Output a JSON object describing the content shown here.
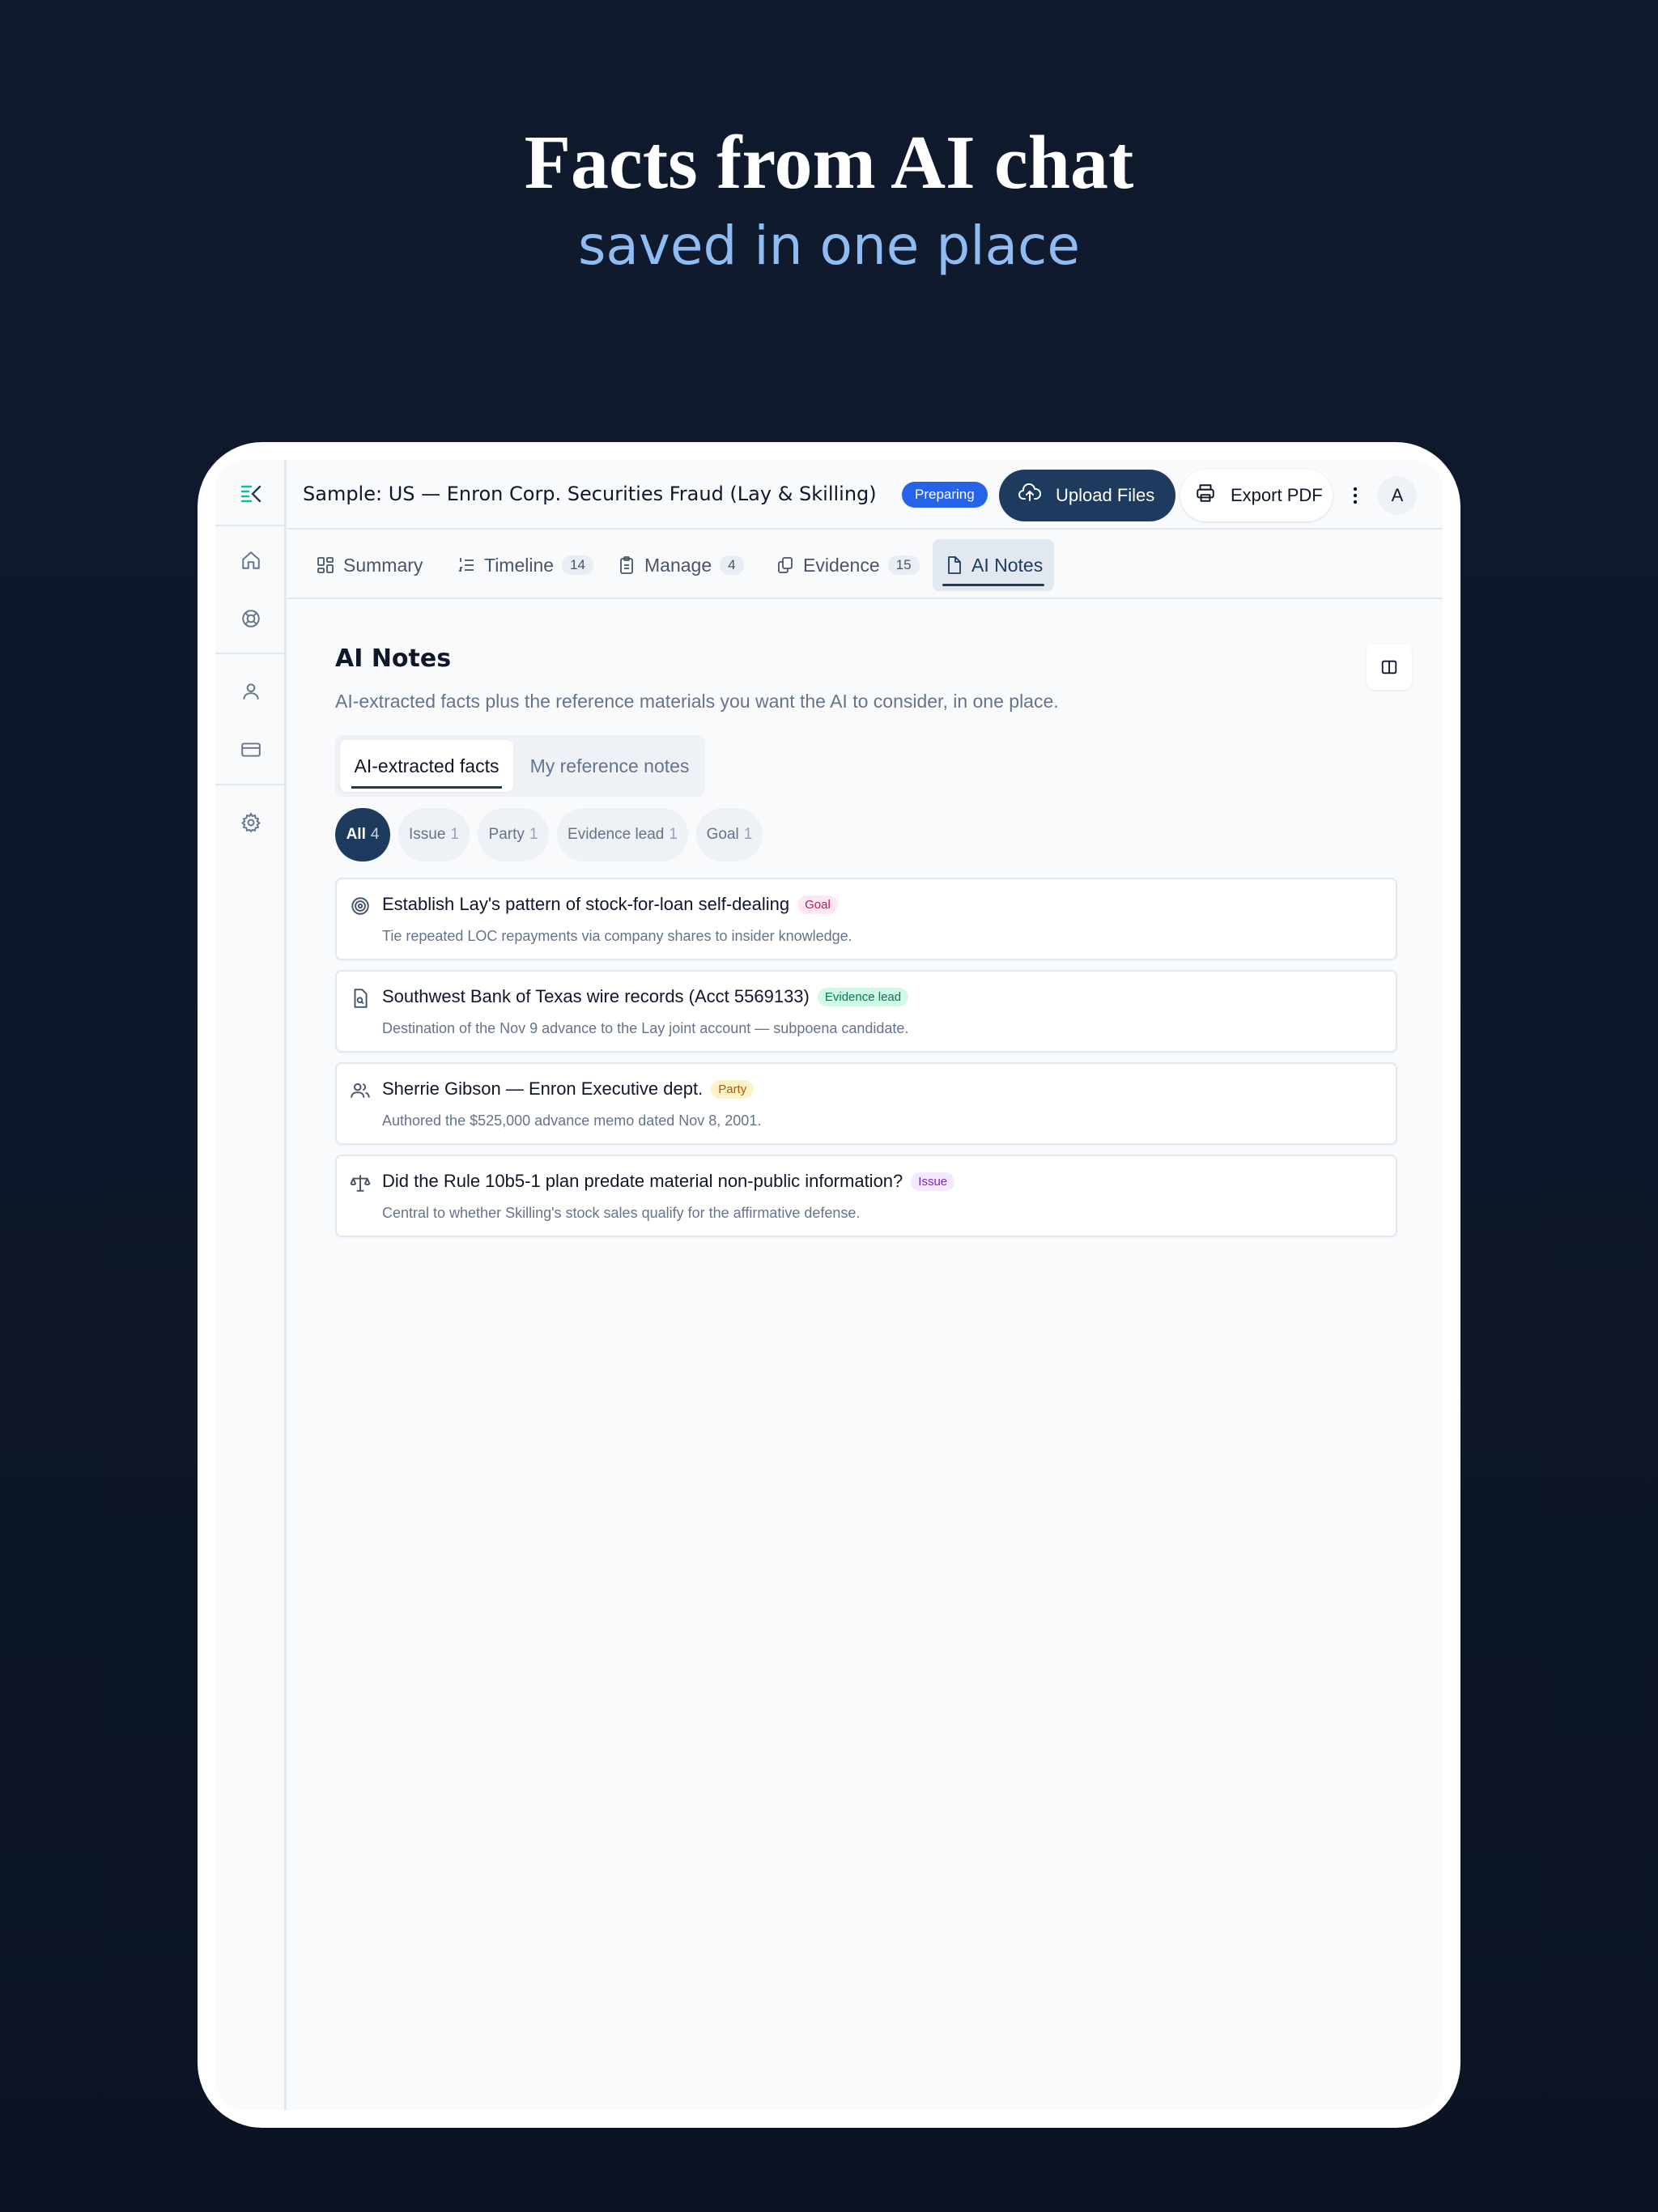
{
  "hero": {
    "title": "Facts from AI chat",
    "subtitle": "saved in one place"
  },
  "sidebar": {
    "items": [
      {
        "name": "logo",
        "icon": "logo-icon"
      },
      {
        "name": "home",
        "icon": "home-icon"
      },
      {
        "name": "help",
        "icon": "lifebuoy-icon"
      },
      {
        "name": "profile",
        "icon": "user-icon"
      },
      {
        "name": "billing",
        "icon": "credit-card-icon"
      },
      {
        "name": "settings",
        "icon": "gear-icon"
      }
    ]
  },
  "header": {
    "case_title": "Sample: US — Enron Corp. Securities Fraud (Lay & Skilling)",
    "status": "Preparing",
    "upload_label": "Upload Files",
    "export_label": "Export PDF",
    "avatar_initial": "A"
  },
  "tabs": [
    {
      "label": "Summary",
      "count": "",
      "icon": "grid-icon"
    },
    {
      "label": "Timeline",
      "count": "14",
      "icon": "list-ordered-icon"
    },
    {
      "label": "Manage",
      "count": "4",
      "icon": "clipboard-icon"
    },
    {
      "label": "Evidence",
      "count": "15",
      "icon": "files-icon"
    },
    {
      "label": "AI Notes",
      "count": "",
      "icon": "file-icon",
      "active": true
    }
  ],
  "main": {
    "title": "AI Notes",
    "description": "AI-extracted facts plus the reference materials you want the AI to consider, in one place.",
    "subtabs": [
      {
        "label": "AI-extracted facts",
        "active": true
      },
      {
        "label": "My reference notes"
      }
    ],
    "filters": [
      {
        "label": "All",
        "count": "4",
        "active": true
      },
      {
        "label": "Issue",
        "count": "1"
      },
      {
        "label": "Party",
        "count": "1"
      },
      {
        "label": "Evidence lead",
        "count": "1"
      },
      {
        "label": "Goal",
        "count": "1"
      }
    ],
    "facts": [
      {
        "title": "Establish Lay's pattern of stock-for-loan self-dealing",
        "tag": "Goal",
        "description": "Tie repeated LOC repayments via company shares to insider knowledge.",
        "icon": "target-icon"
      },
      {
        "title": "Southwest Bank of Texas wire records (Acct 5569133)",
        "tag": "Evidence lead",
        "description": "Destination of the Nov 9 advance to the Lay joint account — subpoena candidate.",
        "icon": "file-search-icon"
      },
      {
        "title": "Sherrie Gibson — Enron Executive dept.",
        "tag": "Party",
        "description": "Authored the $525,000 advance memo dated Nov 8, 2001.",
        "icon": "users-icon"
      },
      {
        "title": "Did the Rule 10b5-1 plan predate material non-public information?",
        "tag": "Issue",
        "description": "Central to whether Skilling's stock sales qualify for the affirmative defense.",
        "icon": "scales-icon"
      }
    ]
  },
  "colors": {
    "background": "#0f172a",
    "hero_subtitle": "#8ebcf3",
    "primary": "#1e3a5f",
    "status_badge": "#2563eb",
    "logo_accent": "#14b8a6"
  }
}
